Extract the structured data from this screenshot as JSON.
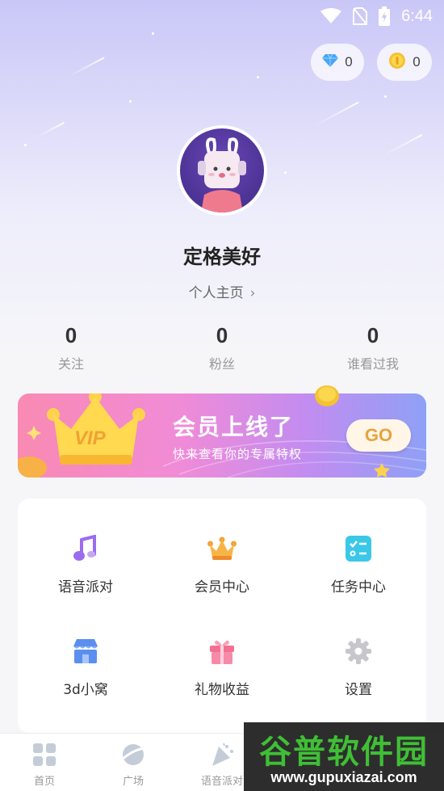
{
  "status_bar": {
    "time": "6:44",
    "icons": [
      "wifi-icon",
      "no-sim-icon",
      "battery-charging-icon"
    ]
  },
  "wallet": {
    "diamond_count": "0",
    "coin_count": "0"
  },
  "profile": {
    "username": "定格美好",
    "homepage_label": "个人主页",
    "homepage_chevron": "›"
  },
  "stats": [
    {
      "value": "0",
      "label": "关注"
    },
    {
      "value": "0",
      "label": "粉丝"
    },
    {
      "value": "0",
      "label": "谁看过我"
    }
  ],
  "banner": {
    "badge": "VIP",
    "title": "会员上线了",
    "subtitle": "快来查看你的专属特权",
    "button_label": "GO"
  },
  "menu": [
    {
      "label": "语音派对",
      "icon": "music-note-icon",
      "color": "#9b6cf0"
    },
    {
      "label": "会员中心",
      "icon": "crown-icon",
      "color": "#f3a33a"
    },
    {
      "label": "任务中心",
      "icon": "task-list-icon",
      "color": "#3bc8e8"
    },
    {
      "label": "3d小窝",
      "icon": "shop-icon",
      "color": "#5a8ff0"
    },
    {
      "label": "礼物收益",
      "icon": "gift-icon",
      "color": "#f46f94"
    },
    {
      "label": "设置",
      "icon": "gear-icon",
      "color": "#c6c6cc"
    }
  ],
  "tabbar": [
    {
      "label": "首页",
      "icon": "home-grid-icon"
    },
    {
      "label": "广场",
      "icon": "planet-icon"
    },
    {
      "label": "语音派对",
      "icon": "party-icon"
    }
  ],
  "watermark": {
    "title": "谷普软件园",
    "url": "www.gupuxiazai.com"
  },
  "colors": {
    "accent": "#f0a234",
    "banner_start": "#f98ab3",
    "banner_end": "#8fa0f6"
  }
}
